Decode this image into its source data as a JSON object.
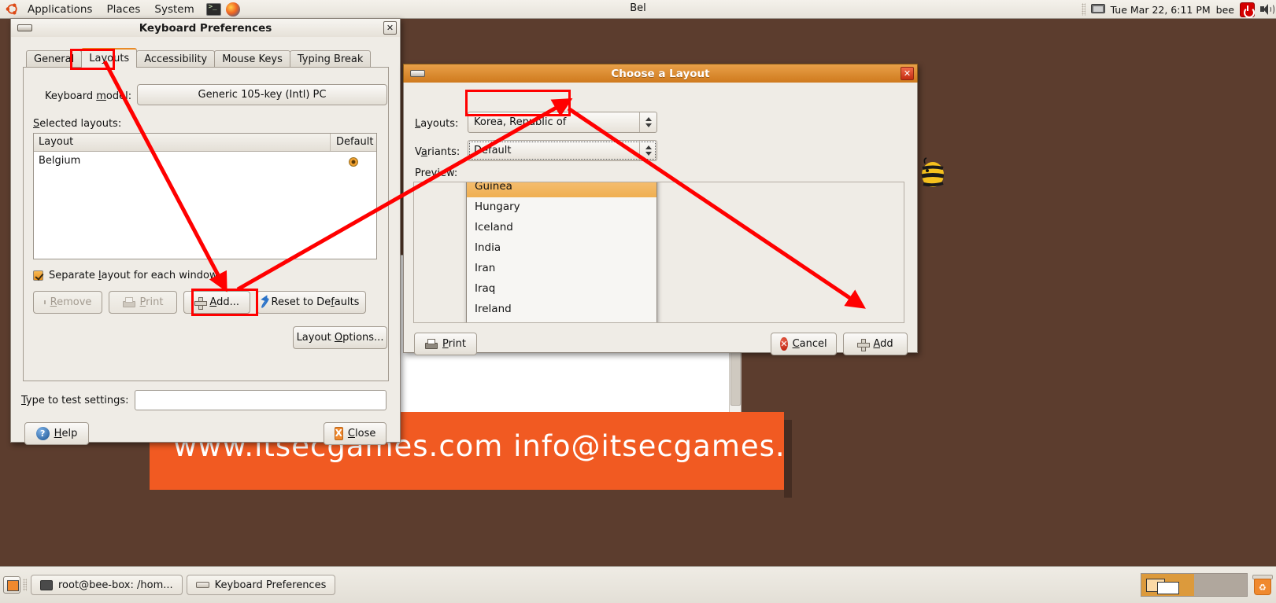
{
  "top_panel": {
    "ubuntu_logo": "ubuntu-logo-icon",
    "menus": [
      "Applications",
      "Places",
      "System"
    ],
    "launchers": [
      "terminal-icon",
      "firefox-icon"
    ],
    "keyboard_indicator": "Bel",
    "monitor_icon": "display-icon",
    "datetime": "Tue Mar 22, 6:11 PM",
    "user": "bee",
    "power_icon": "power-icon",
    "volume_icon": "volume-icon"
  },
  "keyboard_prefs": {
    "title": "Keyboard Preferences",
    "window_icon": "keyboard-icon",
    "close_icon": "✕",
    "tabs": [
      {
        "label": "General",
        "active": false
      },
      {
        "label": "Layouts",
        "active": true
      },
      {
        "label": "Accessibility",
        "active": false
      },
      {
        "label": "Mouse Keys",
        "active": false
      },
      {
        "label": "Typing Break",
        "active": false
      }
    ],
    "model_label": "Keyboard model:",
    "model_value": "Generic 105-key (Intl) PC",
    "selected_layouts_label": "Selected layouts:",
    "columns": [
      "Layout",
      "Default"
    ],
    "rows": [
      {
        "layout": "Belgium",
        "default": true
      }
    ],
    "separate_layout_label": "Separate layout for each window",
    "separate_layout_checked": true,
    "buttons": {
      "remove": "Remove",
      "print": "Print",
      "add": "Add...",
      "reset": "Reset to Defaults",
      "layout_options": "Layout Options..."
    },
    "test_label": "Type to test settings:",
    "test_value": "",
    "help": "Help",
    "close": "Close"
  },
  "choose_layout": {
    "title": "Choose a Layout",
    "window_icon": "keyboard-icon",
    "close_icon": "✕",
    "layouts_label": "Layouts:",
    "layouts_value": "Korea, Republic of",
    "variants_label": "Variants:",
    "variants_value": "Default",
    "preview_label": "Preview:",
    "dropdown_items": [
      {
        "label": "Guinea",
        "selected": true,
        "clipped": true
      },
      {
        "label": "Hungary",
        "selected": false
      },
      {
        "label": "Iceland",
        "selected": false
      },
      {
        "label": "India",
        "selected": false
      },
      {
        "label": "Iran",
        "selected": false
      },
      {
        "label": "Iraq",
        "selected": false
      },
      {
        "label": "Ireland",
        "selected": false
      }
    ],
    "print": "Print",
    "cancel": "Cancel",
    "add": "Add"
  },
  "background_window": {
    "banner_text": "www.itsecgames.com    info@itsecgames.com"
  },
  "bottom_panel": {
    "show_desktop_icon": "show-desktop-icon",
    "tasks": [
      {
        "label": "root@bee-box: /hom...",
        "icon": "terminal-icon"
      },
      {
        "label": "Keyboard Preferences",
        "icon": "keyboard-icon"
      }
    ],
    "workspaces": [
      {
        "active": true
      },
      {
        "active": false
      }
    ],
    "trash_icon": "trash-icon"
  },
  "colors": {
    "desktop": "#5c3d2e",
    "panel": "#efece6",
    "accent_orange": "#f0892e",
    "titlebar_active": "#cf7a1d",
    "annotation_red": "#ff0000",
    "banner": "#f15a22"
  }
}
